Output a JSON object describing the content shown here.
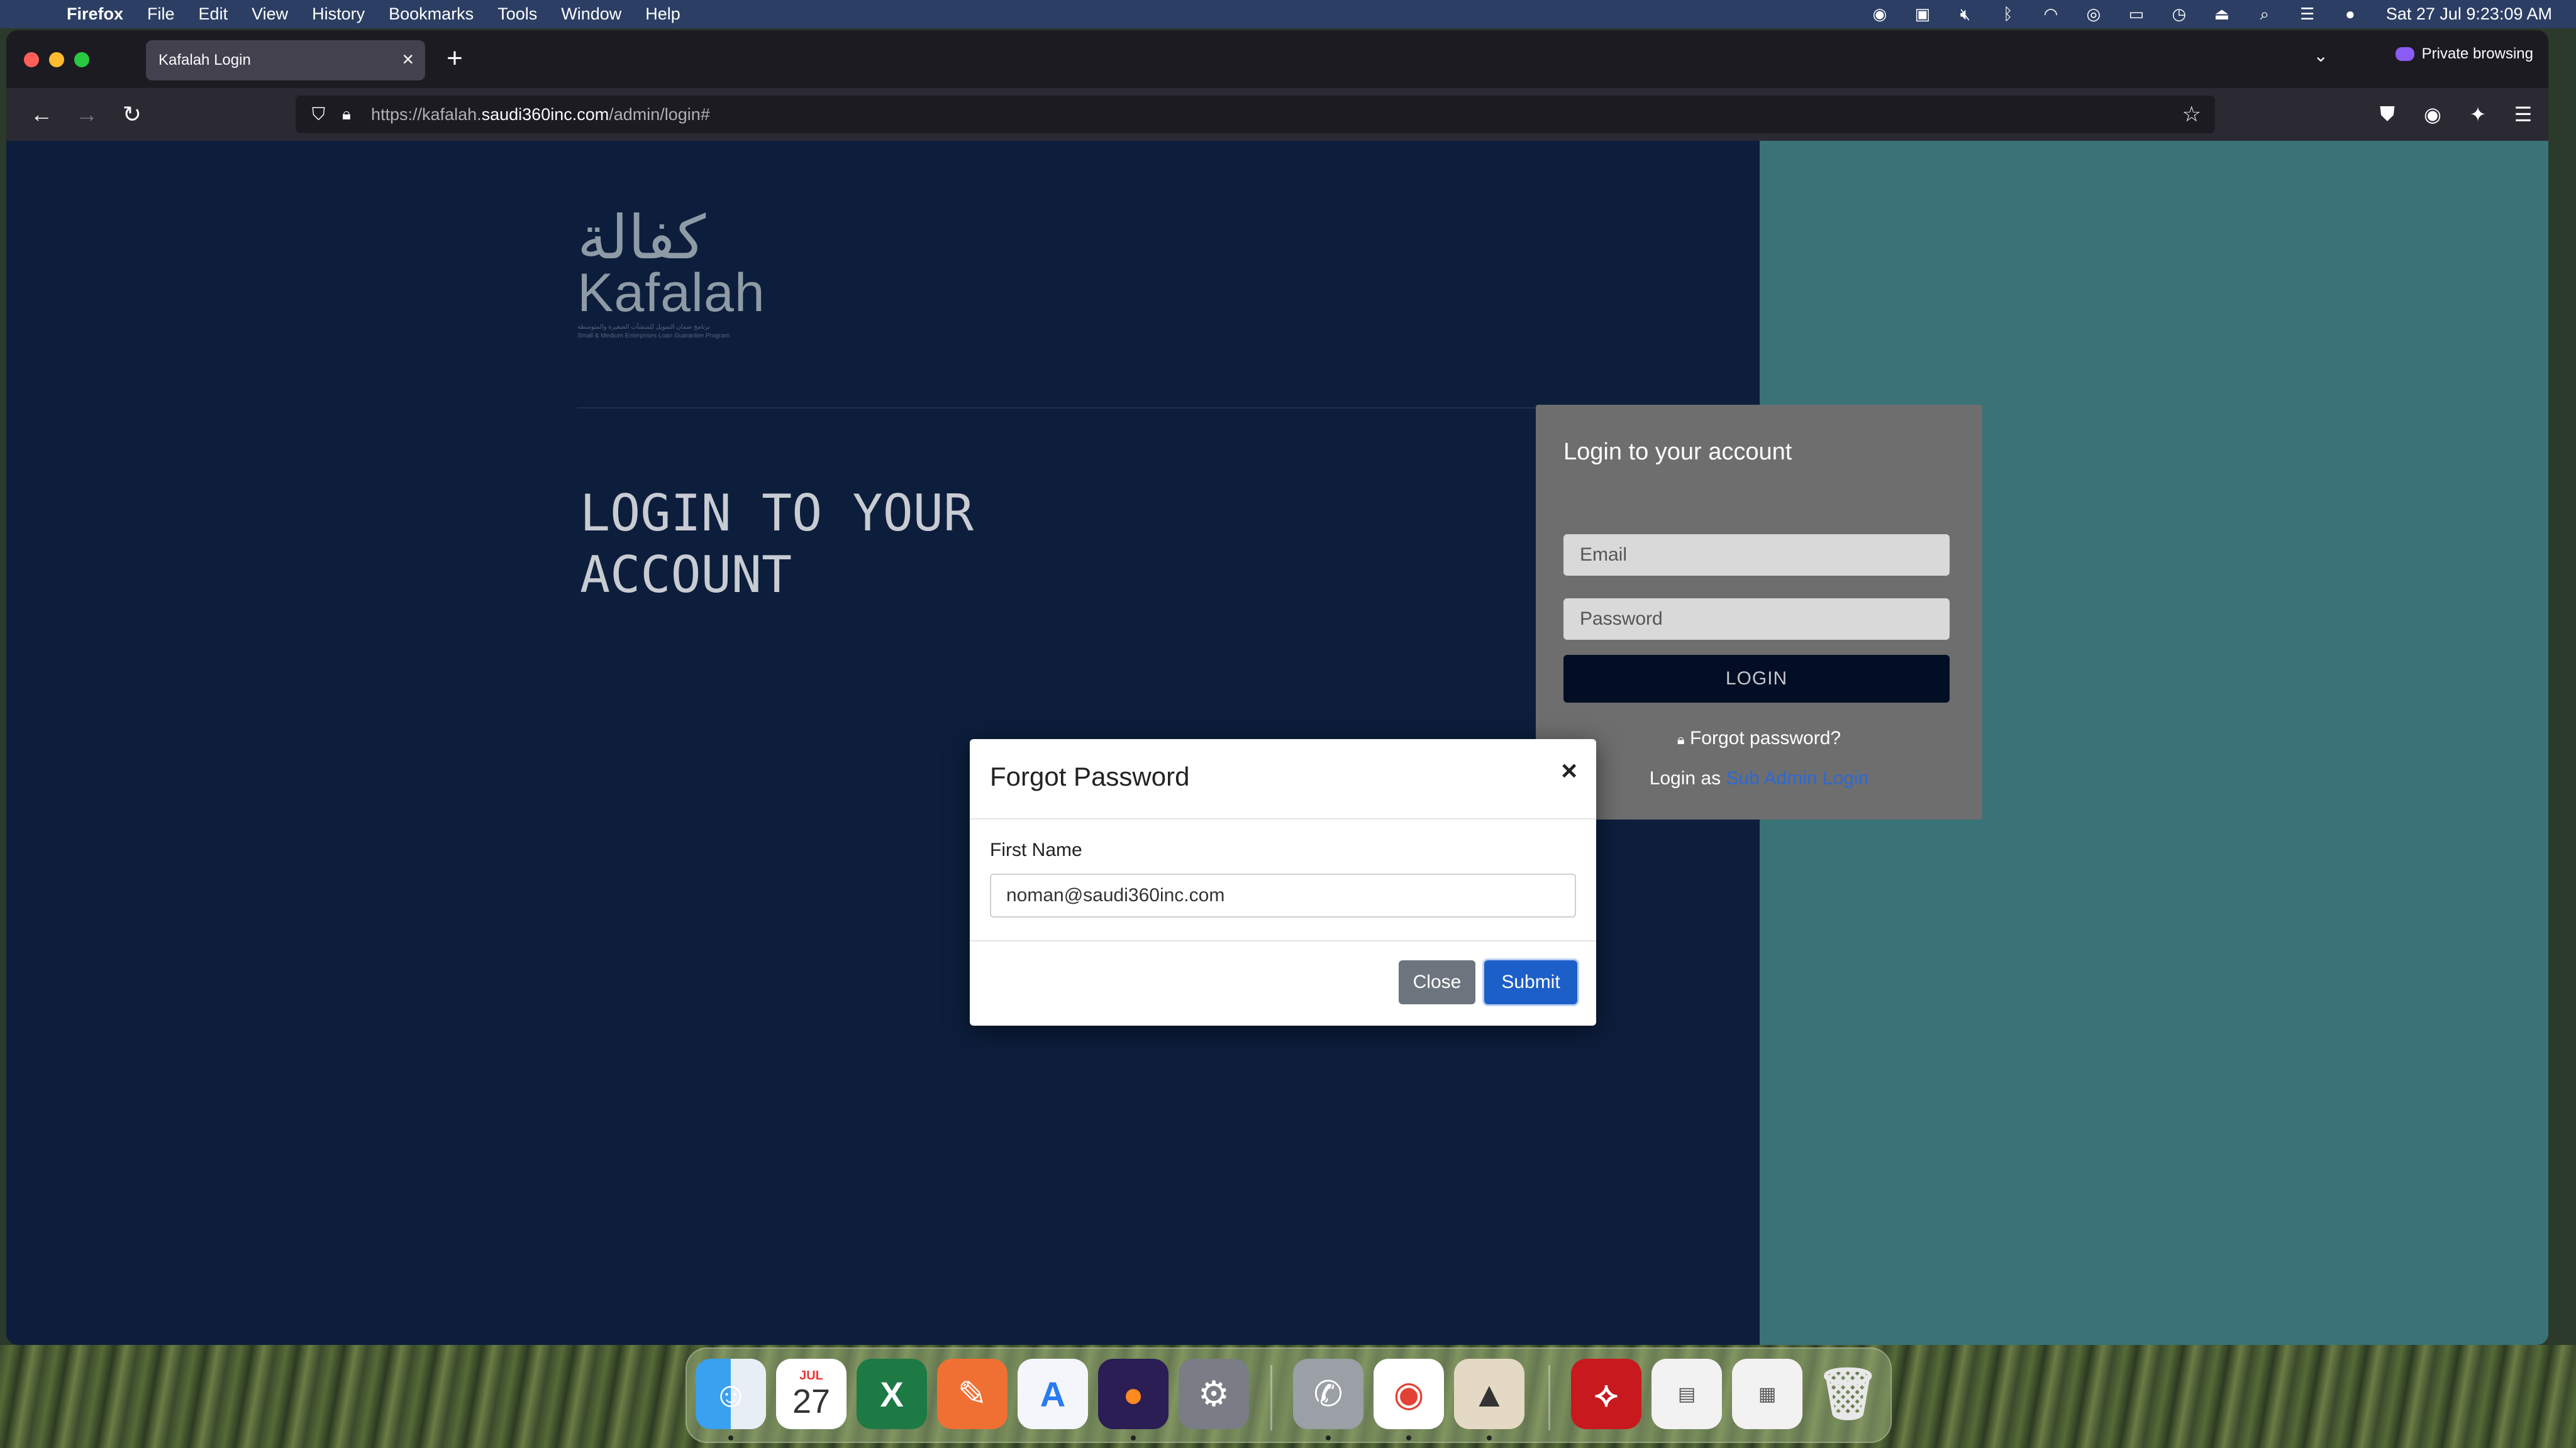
{
  "menubar": {
    "app_name": "Firefox",
    "items": [
      "File",
      "Edit",
      "View",
      "History",
      "Bookmarks",
      "Tools",
      "Window",
      "Help"
    ],
    "clock": "Sat 27 Jul  9:23:09 AM"
  },
  "browser": {
    "tab_title": "Kafalah Login",
    "private_label": "Private browsing",
    "url_prefix": "https://kafalah.",
    "url_domain": "saudi360inc.com",
    "url_path": "/admin/login#"
  },
  "page": {
    "logo_arabic": "كفالة",
    "logo_latin": "Kafalah",
    "logo_sub": "برنامج ضمان التمويل للمنشآت الصغيرة والمتوسطة",
    "logo_sub_en": "Small & Medium Enterprises Loan Guarantee Program",
    "hero_line1": "LOGIN TO YOUR",
    "hero_line2": "ACCOUNT",
    "login_card": {
      "title": "Login to your account",
      "email_placeholder": "Email",
      "password_placeholder": "Password",
      "login_button": "LOGIN",
      "forgot_password": "Forgot password?",
      "login_as_prefix": "Login as ",
      "login_as_link": "Sub Admin Login"
    }
  },
  "modal": {
    "title": "Forgot Password",
    "close_x": "×",
    "field_label": "First Name",
    "field_value": "noman@saudi360inc.com",
    "close_button": "Close",
    "submit_button": "Submit"
  },
  "dock": {
    "calendar_month": "JUL",
    "calendar_day": "27"
  },
  "colors": {
    "page_left_bg": "#0c1e3c",
    "page_right_bg": "#397377",
    "submit_blue": "#1d5fc9",
    "link_blue": "#2c69d4"
  }
}
